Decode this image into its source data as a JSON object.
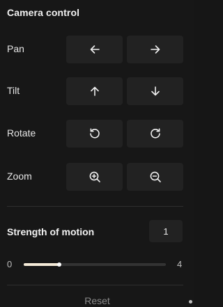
{
  "panel": {
    "title": "Camera control"
  },
  "controls": [
    {
      "label": "Pan",
      "buttons": [
        {
          "icon": "arrow-left-icon",
          "name": "pan-left-button"
        },
        {
          "icon": "arrow-right-icon",
          "name": "pan-right-button"
        }
      ]
    },
    {
      "label": "Tilt",
      "buttons": [
        {
          "icon": "arrow-up-icon",
          "name": "tilt-up-button"
        },
        {
          "icon": "arrow-down-icon",
          "name": "tilt-down-button"
        }
      ]
    },
    {
      "label": "Rotate",
      "buttons": [
        {
          "icon": "rotate-counterclockwise-icon",
          "name": "rotate-ccw-button"
        },
        {
          "icon": "rotate-clockwise-icon",
          "name": "rotate-cw-button"
        }
      ]
    },
    {
      "label": "Zoom",
      "buttons": [
        {
          "icon": "zoom-in-icon",
          "name": "zoom-in-button"
        },
        {
          "icon": "zoom-out-icon",
          "name": "zoom-out-button"
        }
      ]
    }
  ],
  "strength": {
    "label": "Strength of motion",
    "value": "1",
    "min": "0",
    "max": "4",
    "current": 1
  },
  "reset_label": "Reset",
  "colors": {
    "background": "#171717",
    "button": "#222222",
    "slider_fill": "#f4ead8",
    "muted_text": "#8a8a8a"
  }
}
